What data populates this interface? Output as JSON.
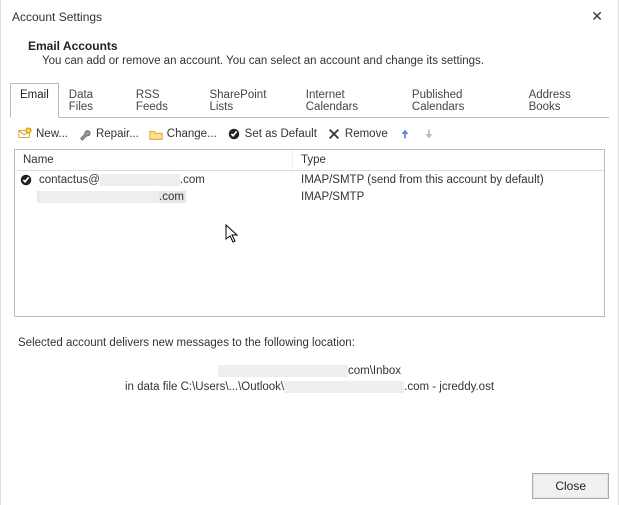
{
  "window": {
    "title": "Account Settings"
  },
  "header": {
    "title": "Email Accounts",
    "desc": "You can add or remove an account. You can select an account and change its settings."
  },
  "tabs": {
    "t0": "Email",
    "t1": "Data Files",
    "t2": "RSS Feeds",
    "t3": "SharePoint Lists",
    "t4": "Internet Calendars",
    "t5": "Published Calendars",
    "t6": "Address Books"
  },
  "toolbar": {
    "new": "New...",
    "repair": "Repair...",
    "change": "Change...",
    "setdefault": "Set as Default",
    "remove": "Remove"
  },
  "columns": {
    "name": "Name",
    "type": "Type"
  },
  "rows": {
    "r0": {
      "prefix": "contactus@",
      "suffix": ".com",
      "type": "IMAP/SMTP (send from this account by default)"
    },
    "r1": {
      "suffix": ".com",
      "type": "IMAP/SMTP"
    }
  },
  "info": {
    "line1": "Selected account delivers new messages to the following location:",
    "folder_suffix": "com\\Inbox",
    "datafile_prefix": "in data file C:\\Users\\...\\Outlook\\",
    "datafile_suffix": ".com - jcreddy.ost"
  },
  "buttons": {
    "close": "Close"
  }
}
